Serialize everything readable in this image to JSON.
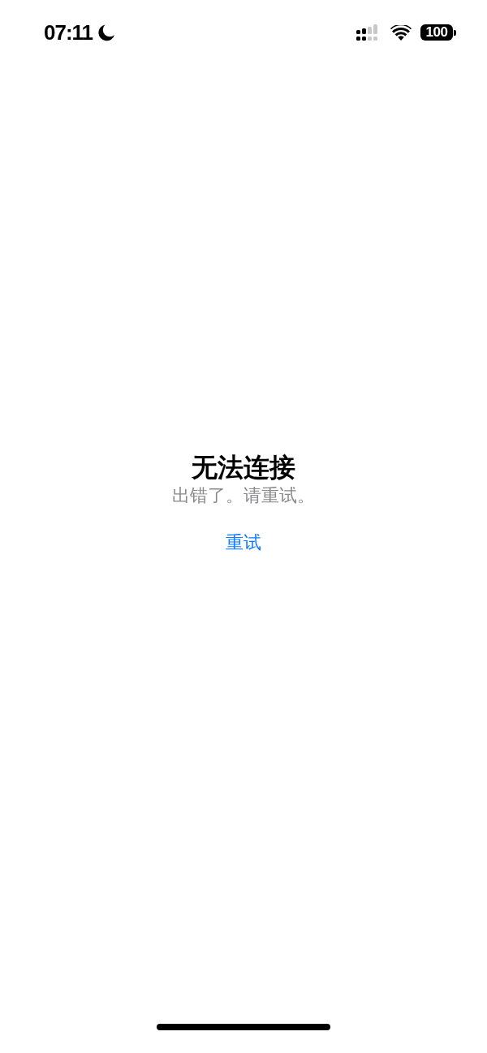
{
  "status_bar": {
    "time": "07:11",
    "battery": "100"
  },
  "message": {
    "title": "无法连接",
    "subtitle": "出错了。请重试。"
  },
  "retry_button": {
    "label": "重试"
  }
}
